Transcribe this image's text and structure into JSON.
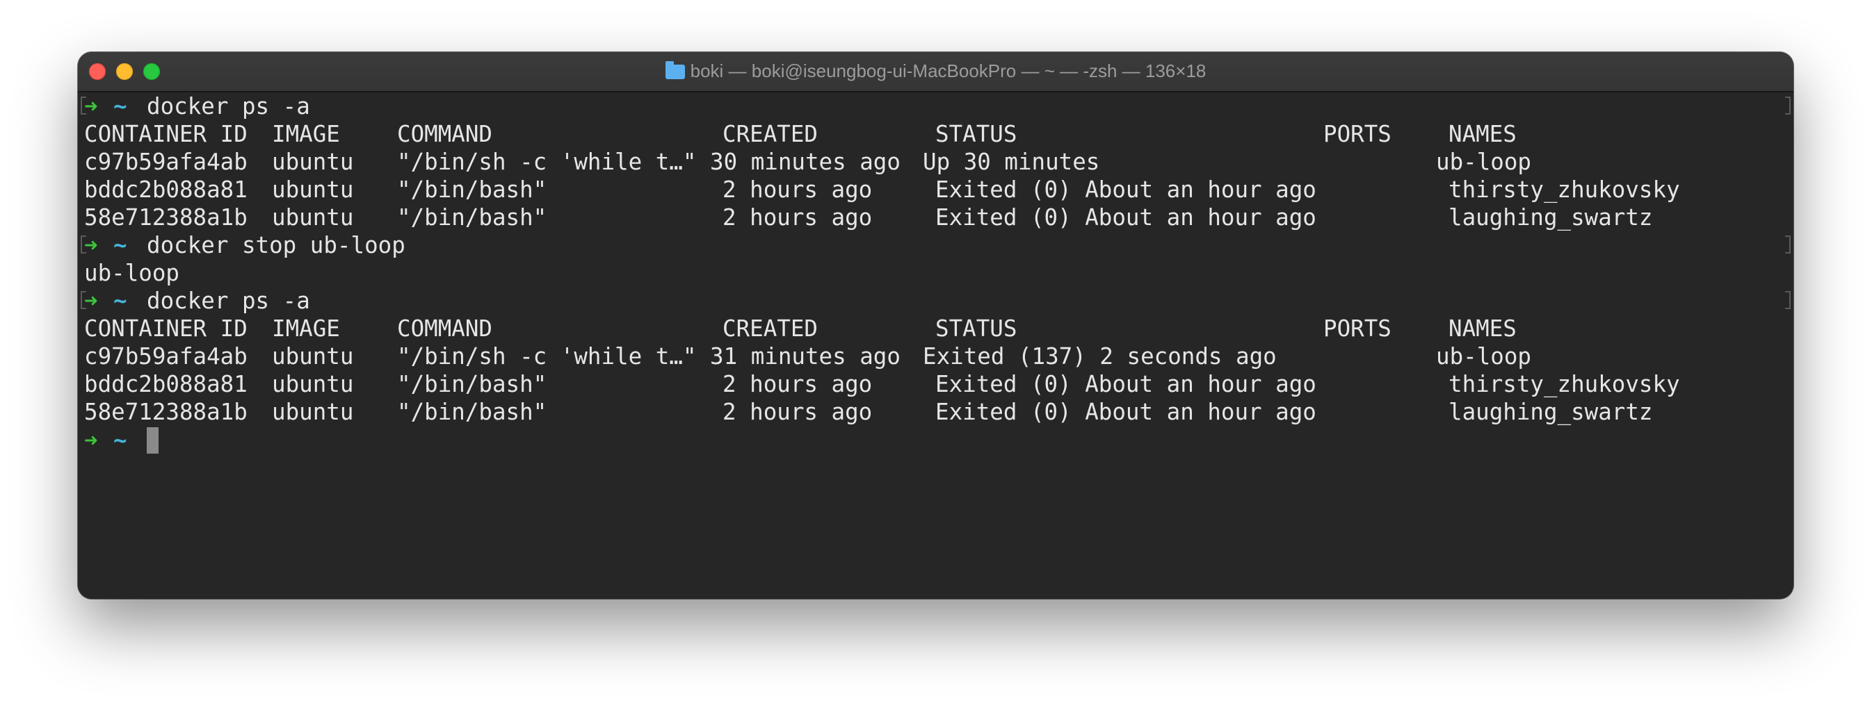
{
  "window": {
    "title": "boki — boki@iseungbog-ui-MacBookPro — ~ — -zsh — 136×18",
    "folder_icon": "folder-icon",
    "colors": {
      "background": "#262626",
      "prompt_arrow": "#3cc43a",
      "prompt_tilde": "#45b4d9",
      "text": "#e6e6e6"
    }
  },
  "prompt": {
    "arrow": "➜",
    "dir": "~"
  },
  "blocks": [
    {
      "command": "docker ps -a",
      "headers": [
        "CONTAINER ID",
        "IMAGE",
        "COMMAND",
        "CREATED",
        "STATUS",
        "PORTS",
        "NAMES"
      ],
      "rows": [
        [
          "c97b59afa4ab",
          "ubuntu",
          "\"/bin/sh -c 'while t…\"",
          "30 minutes ago",
          "Up 30 minutes",
          "",
          "ub-loop"
        ],
        [
          "bddc2b088a81",
          "ubuntu",
          "\"/bin/bash\"",
          "2 hours ago",
          "Exited (0) About an hour ago",
          "",
          "thirsty_zhukovsky"
        ],
        [
          "58e712388a1b",
          "ubuntu",
          "\"/bin/bash\"",
          "2 hours ago",
          "Exited (0) About an hour ago",
          "",
          "laughing_swartz"
        ]
      ]
    },
    {
      "command": "docker stop ub-loop",
      "output": "ub-loop"
    },
    {
      "command": "docker ps -a",
      "headers": [
        "CONTAINER ID",
        "IMAGE",
        "COMMAND",
        "CREATED",
        "STATUS",
        "PORTS",
        "NAMES"
      ],
      "rows": [
        [
          "c97b59afa4ab",
          "ubuntu",
          "\"/bin/sh -c 'while t…\"",
          "31 minutes ago",
          "Exited (137) 2 seconds ago",
          "",
          "ub-loop"
        ],
        [
          "bddc2b088a81",
          "ubuntu",
          "\"/bin/bash\"",
          "2 hours ago",
          "Exited (0) About an hour ago",
          "",
          "thirsty_zhukovsky"
        ],
        [
          "58e712388a1b",
          "ubuntu",
          "\"/bin/bash\"",
          "2 hours ago",
          "Exited (0) About an hour ago",
          "",
          "laughing_swartz"
        ]
      ]
    }
  ]
}
